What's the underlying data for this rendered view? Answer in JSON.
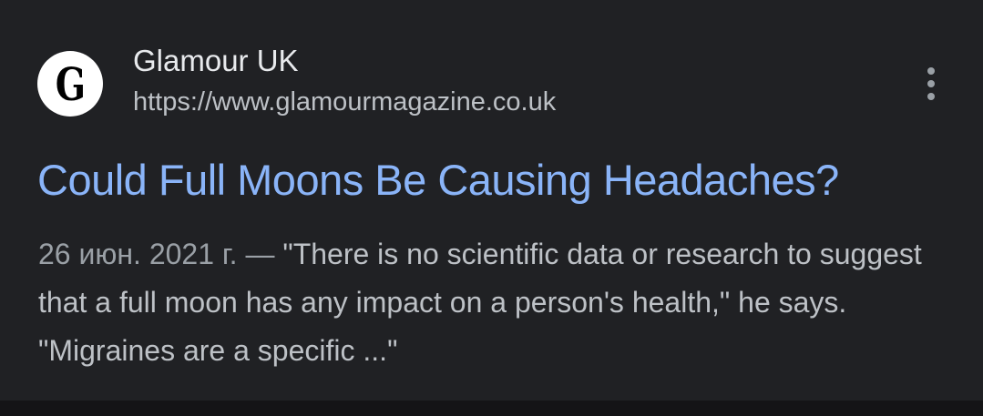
{
  "result": {
    "favicon": {
      "letter": "G",
      "icon": "glamour-logo-icon"
    },
    "site_name": "Glamour UK",
    "url": "https://www.glamourmagazine.co.uk",
    "title": "Could Full Moons Be Causing Headaches?",
    "date": "26 июн. 2021 г. — ",
    "snippet": "\"There is no scientific data or research to suggest that a full moon has any impact on a person's health,\" he says. \"Migraines are a specific ...\"",
    "more_icon": "more-vert-icon"
  },
  "colors": {
    "background": "#202124",
    "title_link": "#8ab4f8",
    "site_name": "#e8eaed",
    "secondary_text": "#bdc1c6",
    "date_text": "#9aa0a6"
  }
}
